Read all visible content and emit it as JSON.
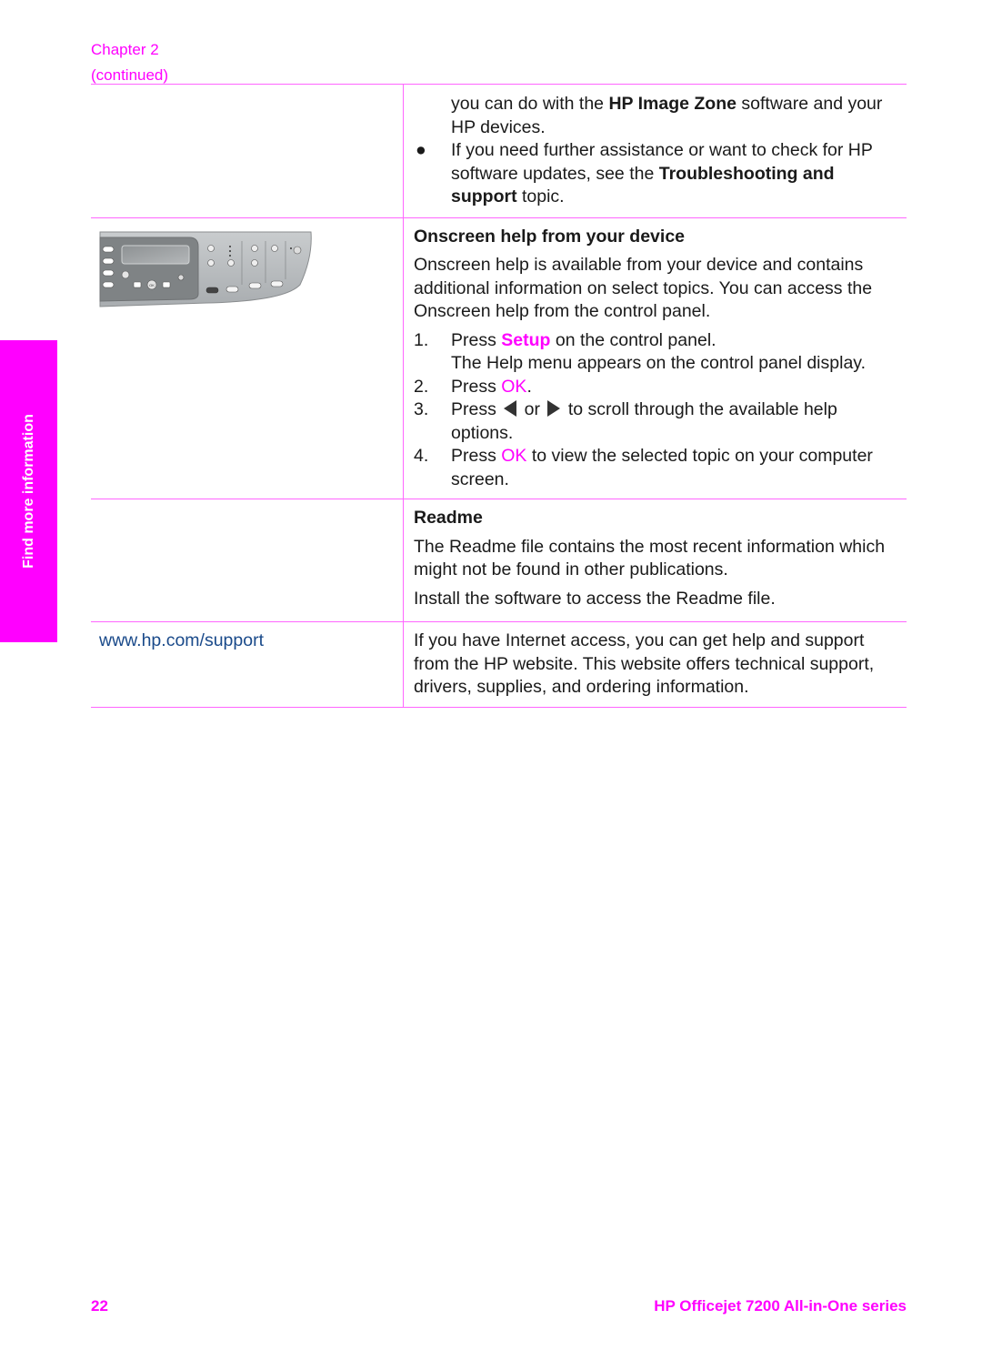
{
  "header": {
    "chapter": "Chapter 2",
    "continued": "(continued)"
  },
  "side_tab": {
    "label": "Find more information"
  },
  "rows": {
    "help_cont": {
      "line1_pre": "you can do with the ",
      "line1_bold": "HP Image Zone",
      "line1_post": " software and your HP devices.",
      "bullet": "●",
      "bullet_pre": "If you need further assistance or want to check for HP software updates, see the ",
      "bullet_bold": "Troubleshooting and support",
      "bullet_post": " topic."
    },
    "onscreen": {
      "image_label": "control-panel-illustration",
      "heading": "Onscreen help from your device",
      "intro": "Onscreen help is available from your device and contains additional information on select topics. You can access the Onscreen help from the control panel.",
      "steps": [
        {
          "num": "1.",
          "pre": "Press ",
          "key": "Setup",
          "post": " on the control panel.",
          "sub": "The Help menu appears on the control panel display."
        },
        {
          "num": "2.",
          "pre": "Press ",
          "key": "OK",
          "post": "."
        },
        {
          "num": "3.",
          "pre": "Press ",
          "mid": " or ",
          "post": " to scroll through the available help options."
        },
        {
          "num": "4.",
          "pre": "Press ",
          "key": "OK",
          "post": " to view the selected topic on your computer screen."
        }
      ]
    },
    "readme": {
      "heading": "Readme",
      "p1": "The Readme file contains the most recent information which might not be found in other publications.",
      "p2": "Install the software to access the Readme file."
    },
    "website": {
      "link": "www.hp.com/support",
      "text": "If you have Internet access, you can get help and support from the HP website. This website offers technical support, drivers, supplies, and ordering information."
    }
  },
  "footer": {
    "page_number": "22",
    "product": "HP Officejet 7200 All-in-One series"
  },
  "colors": {
    "accent": "#ff00ff",
    "link": "#1a4a8a",
    "rule": "#ff66ff"
  }
}
